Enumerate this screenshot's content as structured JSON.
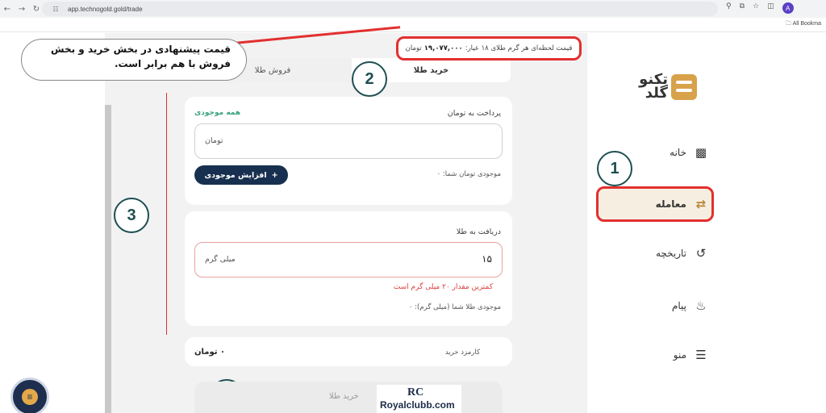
{
  "browser": {
    "url": "app.technogold.gold/trade",
    "bookmarks_label": "All Bookma",
    "avatar_letter": "A"
  },
  "brand": {
    "logo_text_line1": "تکنو",
    "logo_text_line2": "گلد",
    "accent_color": "#d8a24a"
  },
  "sidebar": {
    "items": [
      {
        "label": "خانه",
        "icon": "wallet-icon"
      },
      {
        "label": "معامله",
        "icon": "exchange-icon",
        "active": true
      },
      {
        "label": "تاریخچه",
        "icon": "history-icon"
      },
      {
        "label": "پیام",
        "icon": "bell-icon"
      },
      {
        "label": "منو",
        "icon": "menu-icon"
      }
    ]
  },
  "callouts": {
    "one": "1",
    "two": "2",
    "three": "3",
    "four": "4"
  },
  "price_bar": {
    "label": "قیمت لحظه‌ای هر گرم طلای ۱۸ عیار:",
    "value": "۱۹,۰۷۷,۰۰۰",
    "unit": "تومان"
  },
  "annotation": {
    "text": "قیمت پیشنهادی در بخش خرید و بخش فروش با هم برابر است."
  },
  "tabs": {
    "buy": "خرید طلا",
    "sell": "فروش طلا"
  },
  "pay_card": {
    "title": "پرداخت به تومان",
    "all_balance": "همه موجودی",
    "input_placeholder": "تومان",
    "balance_label": "موجودی تومان شما: ۰",
    "increase_button": "افزایش موجودی"
  },
  "receive_card": {
    "title": "دریافت به طلا",
    "input_value": "۱۵",
    "input_unit": "میلی گرم",
    "error": "کمترین مقدار ۲۰ میلی گرم است",
    "balance_label": "موجودی طلا شما (میلی گرم): ۰"
  },
  "fee_card": {
    "label": "کارمزد خرید",
    "value": "۰ تومان"
  },
  "footer": {
    "buy_button": "خرید طلا"
  },
  "watermark": {
    "logo": "RC",
    "text": "Royalclubb.com"
  }
}
